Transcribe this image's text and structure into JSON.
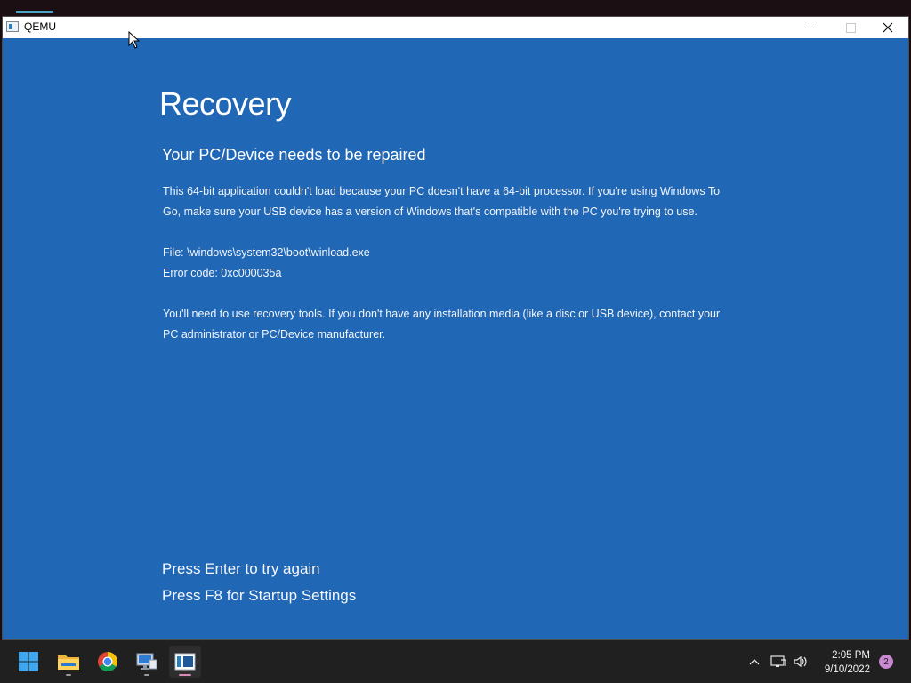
{
  "window": {
    "title": "QEMU",
    "controls": {
      "minimize_icon": "minimize-icon",
      "maximize_icon": "maximize-icon",
      "close_icon": "close-icon"
    }
  },
  "recovery": {
    "title": "Recovery",
    "subtitle": "Your PC/Device needs to be repaired",
    "paragraph1": "This 64-bit application couldn't load because your PC doesn't have a 64-bit processor. If you're using Windows To Go, make sure your USB device has a version of Windows that's compatible with the PC you're trying to use.",
    "file_line": "File: \\windows\\system32\\boot\\winload.exe",
    "error_line": "Error code: 0xc000035a",
    "paragraph3": "You'll need to use recovery tools. If you don't have any installation media (like a disc or USB device), contact your PC administrator or PC/Device manufacturer.",
    "key_enter": "Press Enter to try again",
    "key_f8": "Press F8 for Startup Settings"
  },
  "taskbar": {
    "items": [
      {
        "icon": "windows-start-icon"
      },
      {
        "icon": "file-explorer-icon"
      },
      {
        "icon": "chrome-icon"
      },
      {
        "icon": "remote-desktop-icon"
      },
      {
        "icon": "qemu-icon",
        "active": true
      }
    ],
    "tray": {
      "time": "2:05 PM",
      "date": "9/10/2022",
      "notification_count": "2"
    }
  },
  "colors": {
    "bsod_blue": "#2067b5",
    "taskbar": "#202020",
    "badge": "#c78ad0"
  }
}
